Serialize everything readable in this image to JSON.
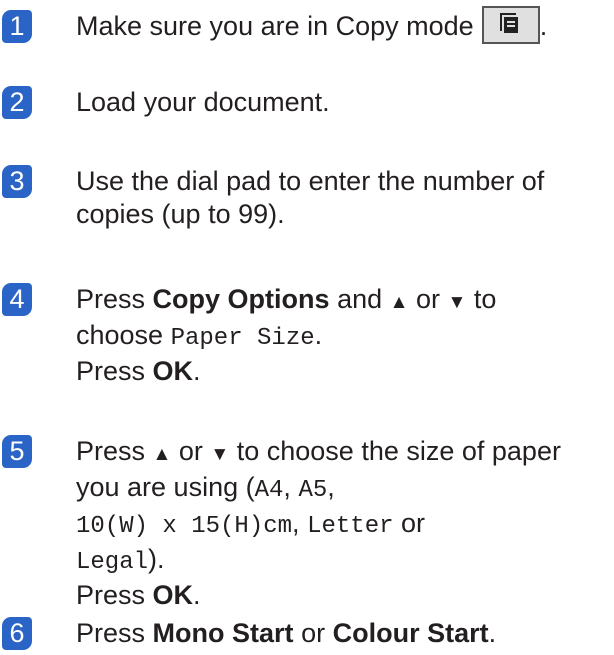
{
  "steps": [
    {
      "num": "1",
      "prefix": "Make sure you are in Copy mode",
      "suffix": "."
    },
    {
      "num": "2",
      "text": "Load your document."
    },
    {
      "num": "3",
      "line1": "Use the dial pad to enter the number of",
      "line2": "copies (up to 99)."
    },
    {
      "num": "4",
      "press": "Press",
      "copy_options": "Copy Options",
      "and": "and",
      "up": "▲",
      "or": "or",
      "down": "▼",
      "to": "to",
      "choose": "choose",
      "paper_size": "Paper Size",
      "period": ".",
      "press2": "Press",
      "ok": "OK",
      "period2": "."
    },
    {
      "num": "5",
      "press": "Press",
      "up": "▲",
      "or": "or",
      "down": "▼",
      "rest": "to choose the size of paper",
      "line2a": "you are using (",
      "a4": "A4",
      "comma1": ",",
      "a5": "A5",
      "comma2": ",",
      "size10": "10(W) x 15(H)cm",
      "comma3": ",",
      "letter": "Letter",
      "or2": "or",
      "legal": "Legal",
      "close": ").",
      "press2": "Press",
      "ok": "OK",
      "period": "."
    },
    {
      "num": "6",
      "press": "Press",
      "mono_start": "Mono Start",
      "or": "or",
      "colour_start": "Colour Start",
      "period": "."
    }
  ],
  "icons": {
    "copy_mode": "copy-mode-button-icon"
  },
  "colors": {
    "badge": "#2a64c6",
    "text": "#231f20"
  }
}
